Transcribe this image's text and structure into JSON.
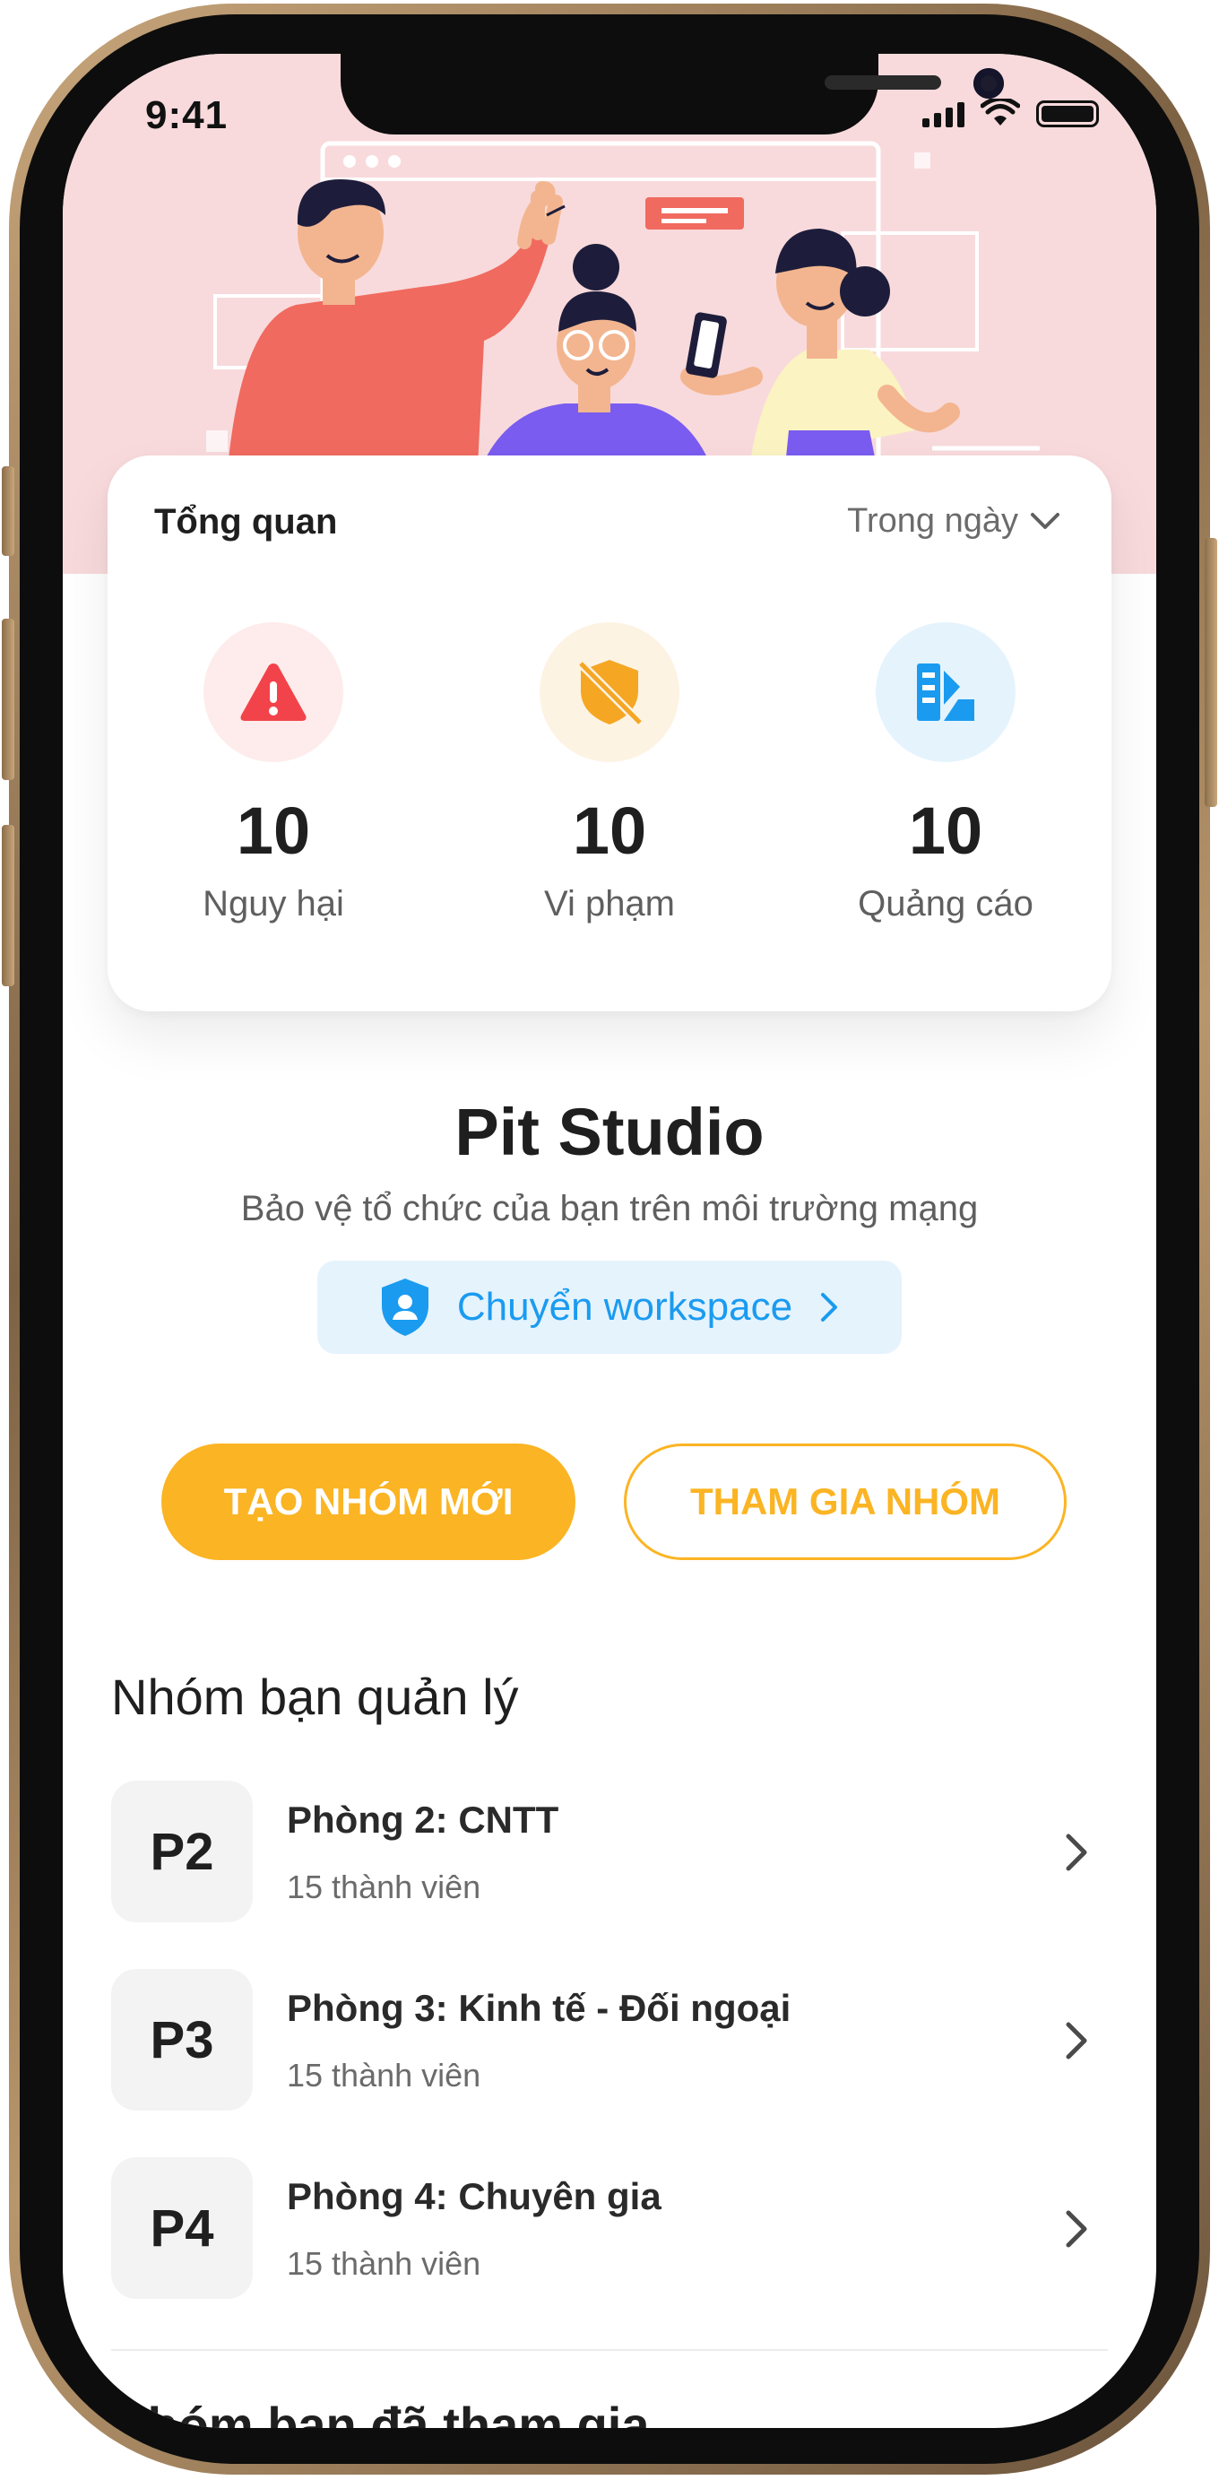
{
  "status_bar": {
    "time": "9:41"
  },
  "overview": {
    "title": "Tổng quan",
    "period": "Trong ngày",
    "stats": [
      {
        "value": "10",
        "label": "Nguy hại",
        "icon": "alert-triangle-icon",
        "bg": "#fdeceb",
        "color": "#f2434a"
      },
      {
        "value": "10",
        "label": "Vi phạm",
        "icon": "shield-off-icon",
        "bg": "#fdf3e3",
        "color": "#f5a623"
      },
      {
        "value": "10",
        "label": "Quảng cáo",
        "icon": "ads-icon",
        "bg": "#e5f3fd",
        "color": "#1a9bf0"
      }
    ]
  },
  "org": {
    "name": "Pit Studio",
    "tagline": "Bảo vệ tổ chức của bạn trên môi trường mạng",
    "switch_label": "Chuyển workspace"
  },
  "actions": {
    "create_label": "TẠO NHÓM MỚI",
    "join_label": "THAM GIA NHÓM"
  },
  "managed_groups": {
    "title": "Nhóm bạn quản lý",
    "items": [
      {
        "code": "P2",
        "name": "Phòng 2: CNTT",
        "members": "15 thành viên"
      },
      {
        "code": "P3",
        "name": "Phòng 3: Kinh tế - Đối ngoại",
        "members": "15 thành viên"
      },
      {
        "code": "P4",
        "name": "Phòng 4: Chuyên gia",
        "members": "15 thành viên"
      }
    ]
  },
  "joined_groups": {
    "title": "Nhóm bạn đã tham gia"
  },
  "colors": {
    "accent": "#fbb423",
    "link": "#1a9bf0",
    "hero_bg": "#f8dadc"
  }
}
